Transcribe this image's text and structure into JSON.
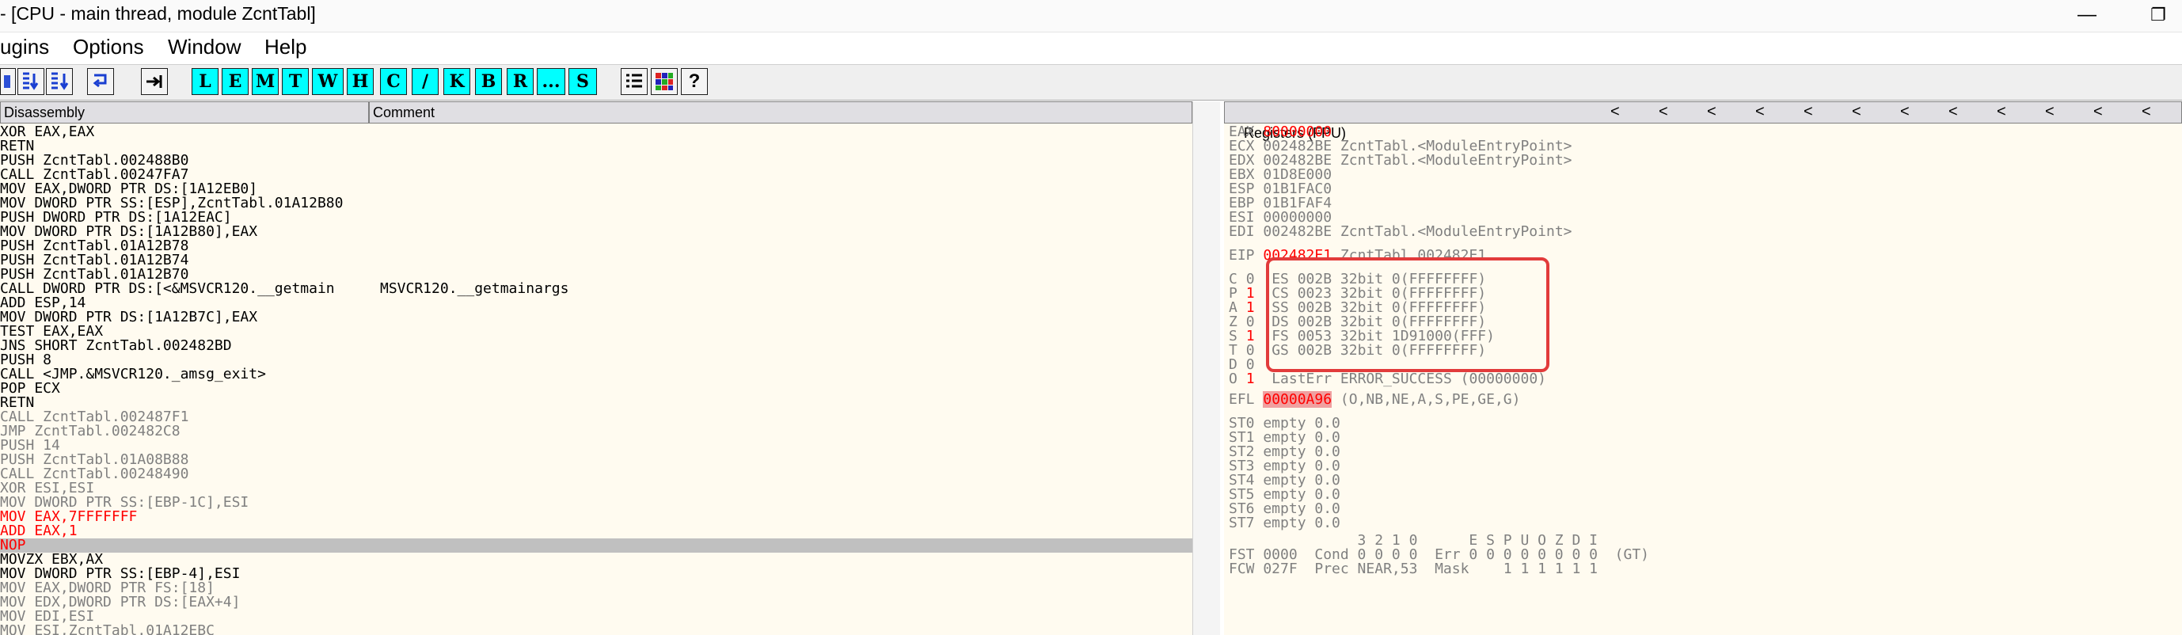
{
  "window": {
    "title": "- [CPU - main thread, module ZcntTabl]",
    "minimize": "—",
    "restore": "❐"
  },
  "menu": [
    "ugins",
    "Options",
    "Window",
    "Help"
  ],
  "toolbar": {
    "letters": [
      "L",
      "E",
      "M",
      "T",
      "W",
      "H",
      "C",
      "/",
      "K",
      "B",
      "R",
      "...",
      "S"
    ],
    "icons": [
      "step-into-icon",
      "step-over-icon",
      "execute-till-return-icon",
      "goto-icon",
      "list-icon",
      "grid-colors-icon",
      "help-icon"
    ]
  },
  "disassembly": {
    "header_left": "Disassembly",
    "header_right": "Comment",
    "rows": [
      {
        "ins": "XOR EAX,EAX",
        "style": "normal"
      },
      {
        "ins": "RETN",
        "style": "normal"
      },
      {
        "ins": "PUSH ZcntTabl.002488B0",
        "style": "normal"
      },
      {
        "ins": "CALL ZcntTabl.00247FA7",
        "style": "normal"
      },
      {
        "ins": "MOV EAX,DWORD PTR DS:[1A12EB0]",
        "style": "normal"
      },
      {
        "ins": "MOV DWORD PTR SS:[ESP],ZcntTabl.01A12B80",
        "style": "normal"
      },
      {
        "ins": "PUSH DWORD PTR DS:[1A12EAC]",
        "style": "normal"
      },
      {
        "ins": "MOV DWORD PTR DS:[1A12B80],EAX",
        "style": "normal"
      },
      {
        "ins": "PUSH ZcntTabl.01A12B78",
        "style": "normal"
      },
      {
        "ins": "PUSH ZcntTabl.01A12B74",
        "style": "normal"
      },
      {
        "ins": "PUSH ZcntTabl.01A12B70",
        "style": "normal"
      },
      {
        "ins": "CALL DWORD PTR DS:[<&MSVCR120.__getmain",
        "style": "normal",
        "comment": "MSVCR120.__getmainargs"
      },
      {
        "ins": "ADD ESP,14",
        "style": "normal"
      },
      {
        "ins": "MOV DWORD PTR DS:[1A12B7C],EAX",
        "style": "normal"
      },
      {
        "ins": "TEST EAX,EAX",
        "style": "normal"
      },
      {
        "ins": "JNS SHORT ZcntTabl.002482BD",
        "style": "normal"
      },
      {
        "ins": "PUSH 8",
        "style": "normal"
      },
      {
        "ins": "CALL <JMP.&MSVCR120._amsg_exit>",
        "style": "normal"
      },
      {
        "ins": "POP ECX",
        "style": "normal"
      },
      {
        "ins": "RETN",
        "style": "normal"
      },
      {
        "ins": "CALL ZcntTabl.002487F1",
        "style": "gray"
      },
      {
        "ins": "JMP ZcntTabl.002482C8",
        "style": "gray"
      },
      {
        "ins": "PUSH 14",
        "style": "gray"
      },
      {
        "ins": "PUSH ZcntTabl.01A08B88",
        "style": "gray"
      },
      {
        "ins": "CALL ZcntTabl.00248490",
        "style": "gray"
      },
      {
        "ins": "XOR ESI,ESI",
        "style": "gray"
      },
      {
        "ins": "MOV DWORD PTR SS:[EBP-1C],ESI",
        "style": "gray"
      },
      {
        "ins": "MOV EAX,7FFFFFFF",
        "style": "red"
      },
      {
        "ins": "ADD EAX,1",
        "style": "red"
      },
      {
        "ins": "NOP",
        "style": "selected"
      },
      {
        "ins": "MOVZX EBX,AX",
        "style": "normal"
      },
      {
        "ins": "MOV DWORD PTR SS:[EBP-4],ESI",
        "style": "normal"
      },
      {
        "ins": "MOV EAX,DWORD PTR FS:[18]",
        "style": "gray"
      },
      {
        "ins": "MOV EDX,DWORD PTR DS:[EAX+4]",
        "style": "gray"
      },
      {
        "ins": "MOV EDI,ESI",
        "style": "gray"
      },
      {
        "ins": "MOV ESI,ZcntTabl.01A12EBC",
        "style": "gray"
      }
    ]
  },
  "registers": {
    "header": "Registers (FPU)",
    "gp": [
      {
        "name": "EAX",
        "value": "80000000",
        "changed": true,
        "comment": ""
      },
      {
        "name": "ECX",
        "value": "002482BE",
        "changed": false,
        "comment": "ZcntTabl.<ModuleEntryPoint>"
      },
      {
        "name": "EDX",
        "value": "002482BE",
        "changed": false,
        "comment": "ZcntTabl.<ModuleEntryPoint>"
      },
      {
        "name": "EBX",
        "value": "01D8E000",
        "changed": false,
        "comment": ""
      },
      {
        "name": "ESP",
        "value": "01B1FAC0",
        "changed": false,
        "comment": ""
      },
      {
        "name": "EBP",
        "value": "01B1FAF4",
        "changed": false,
        "comment": ""
      },
      {
        "name": "ESI",
        "value": "00000000",
        "changed": false,
        "comment": ""
      },
      {
        "name": "EDI",
        "value": "002482BE",
        "changed": false,
        "comment": "ZcntTabl.<ModuleEntryPoint>"
      }
    ],
    "eip": {
      "name": "EIP",
      "value": "002482E1",
      "comment": "ZcntTabl.002482E1"
    },
    "flags": [
      {
        "flag": "C",
        "bit": "0",
        "red": false,
        "seg": "ES 002B 32bit 0(FFFFFFFF)"
      },
      {
        "flag": "P",
        "bit": "1",
        "red": true,
        "seg": "CS 0023 32bit 0(FFFFFFFF)"
      },
      {
        "flag": "A",
        "bit": "1",
        "red": true,
        "seg": "SS 002B 32bit 0(FFFFFFFF)"
      },
      {
        "flag": "Z",
        "bit": "0",
        "red": false,
        "seg": "DS 002B 32bit 0(FFFFFFFF)"
      },
      {
        "flag": "S",
        "bit": "1",
        "red": true,
        "seg": "FS 0053 32bit 1D91000(FFF)"
      },
      {
        "flag": "T",
        "bit": "0",
        "red": false,
        "seg": "GS 002B 32bit 0(FFFFFFFF)"
      },
      {
        "flag": "D",
        "bit": "0",
        "red": false,
        "seg": ""
      },
      {
        "flag": "O",
        "bit": "1",
        "red": true,
        "seg": "LastErr ERROR_SUCCESS (00000000)"
      }
    ],
    "efl": {
      "name": "EFL",
      "value": "00000A96",
      "decoded": "(O,NB,NE,A,S,PE,GE,G)"
    },
    "fpu": [
      "ST0 empty 0.0",
      "ST1 empty 0.0",
      "ST2 empty 0.0",
      "ST3 empty 0.0",
      "ST4 empty 0.0",
      "ST5 empty 0.0",
      "ST6 empty 0.0",
      "ST7 empty 0.0"
    ],
    "fpu_status": [
      "               3 2 1 0      E S P U O Z D I",
      "FST 0000  Cond 0 0 0 0  Err 0 0 0 0 0 0 0 0  (GT)",
      "FCW 027F  Prec NEAR,53  Mask    1 1 1 1 1 1"
    ],
    "arrows": [
      "<",
      "<",
      "<",
      "<",
      "<",
      "<",
      "<",
      "<",
      "<",
      "<",
      "<",
      "<"
    ]
  },
  "colors": {
    "panel_bg": "#fffbf0",
    "changed_red": "#ff0000",
    "gray_text": "#808080",
    "selected_row": "#c0c0c0",
    "efl_highlight": "#f0a0a0",
    "annotation_box": "#e23b3b",
    "toolbar_letter_bg": "#00ffff"
  }
}
